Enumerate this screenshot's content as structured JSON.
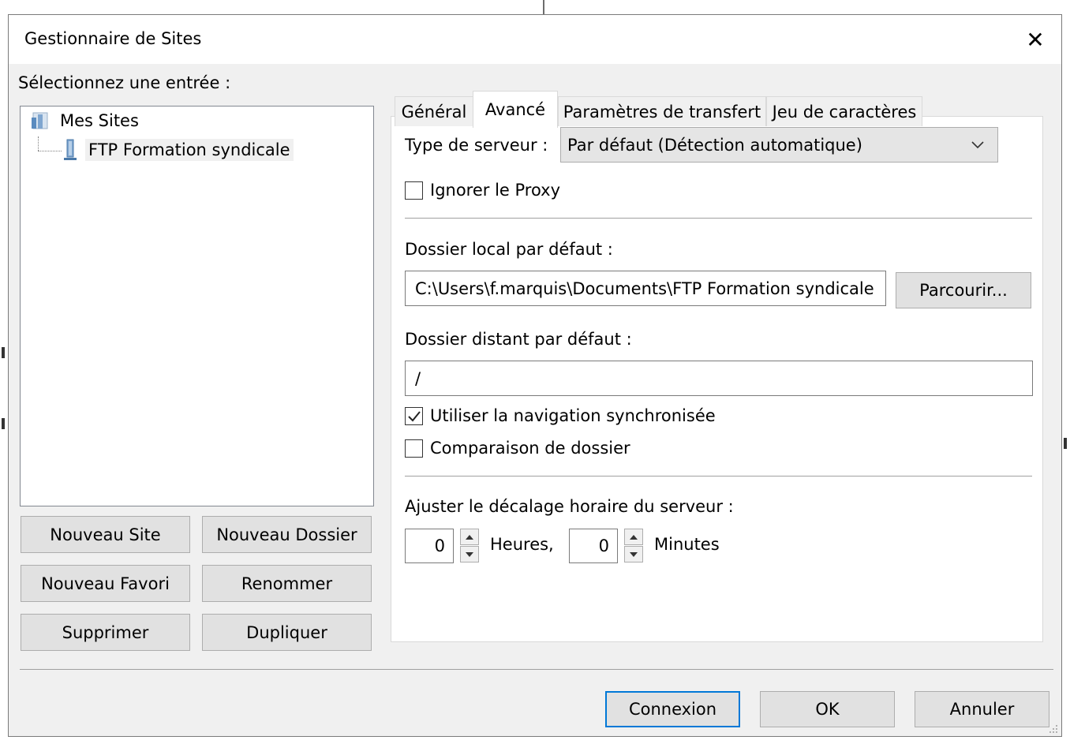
{
  "window": {
    "title": "Gestionnaire de Sites",
    "close_glyph": "✕"
  },
  "left": {
    "select_label": "Sélectionnez une entrée :",
    "tree": {
      "root": {
        "label": "Mes Sites",
        "icon": "folder-icon"
      },
      "child": {
        "label": "FTP Formation syndicale",
        "icon": "server-icon"
      }
    },
    "buttons": {
      "new_site": "Nouveau Site",
      "new_folder": "Nouveau Dossier",
      "new_bookmark": "Nouveau Favori",
      "rename": "Renommer",
      "delete": "Supprimer",
      "duplicate": "Dupliquer"
    }
  },
  "tabs": [
    {
      "label": "Général",
      "active": false
    },
    {
      "label": "Avancé",
      "active": true
    },
    {
      "label": "Paramètres de transfert",
      "active": false
    },
    {
      "label": "Jeu de caractères",
      "active": false
    }
  ],
  "advanced": {
    "server_type_label": "Type de serveur :",
    "server_type_value": "Par défaut (Détection automatique)",
    "bypass_proxy": {
      "label": "Ignorer le Proxy",
      "checked": false
    },
    "local_dir_label": "Dossier local par défaut :",
    "local_dir_value": "C:\\Users\\f.marquis\\Documents\\FTP Formation syndicale",
    "browse_label": "Parcourir...",
    "remote_dir_label": "Dossier distant par défaut :",
    "remote_dir_value": "/",
    "sync_browsing": {
      "label": "Utiliser la navigation synchronisée",
      "checked": true
    },
    "dir_comparison": {
      "label": "Comparaison de dossier",
      "checked": false
    },
    "timezone_label": "Ajuster le décalage horaire du serveur :",
    "hours_value": "0",
    "hours_label": "Heures,",
    "minutes_value": "0",
    "minutes_label": "Minutes"
  },
  "footer": {
    "connect": "Connexion",
    "ok": "OK",
    "cancel": "Annuler"
  },
  "colors": {
    "focus_border": "#0078d7",
    "dialog_bg": "#f0f0f0"
  }
}
